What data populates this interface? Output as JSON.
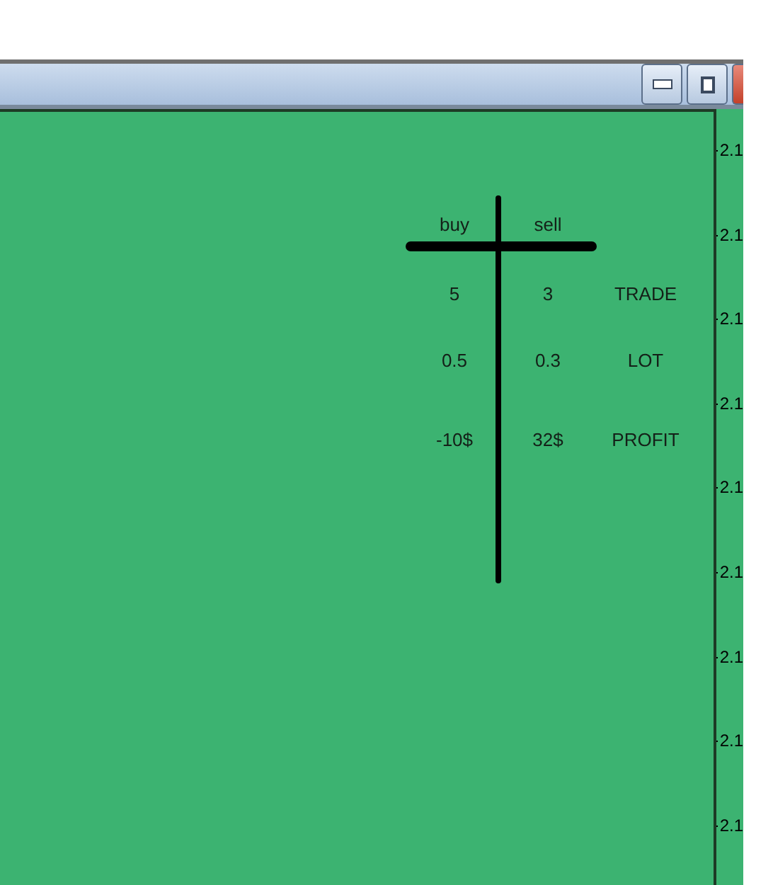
{
  "window": {
    "buttons": [
      {
        "kind": "minimize"
      },
      {
        "kind": "maximize"
      },
      {
        "kind": "close"
      }
    ]
  },
  "table": {
    "columns": [
      "buy",
      "sell"
    ],
    "rows": [
      {
        "buy": "5",
        "sell": "3",
        "label": "TRADE"
      },
      {
        "buy": "0.5",
        "sell": "0.3",
        "label": "LOT"
      },
      {
        "buy": "-10$",
        "sell": "32$",
        "label": "PROFIT"
      }
    ]
  },
  "price_axis": {
    "labels": [
      "2.1",
      "2.1",
      "2.1",
      "2.1",
      "2.1",
      "2.1",
      "2.1",
      "2.1",
      "2.1"
    ]
  }
}
